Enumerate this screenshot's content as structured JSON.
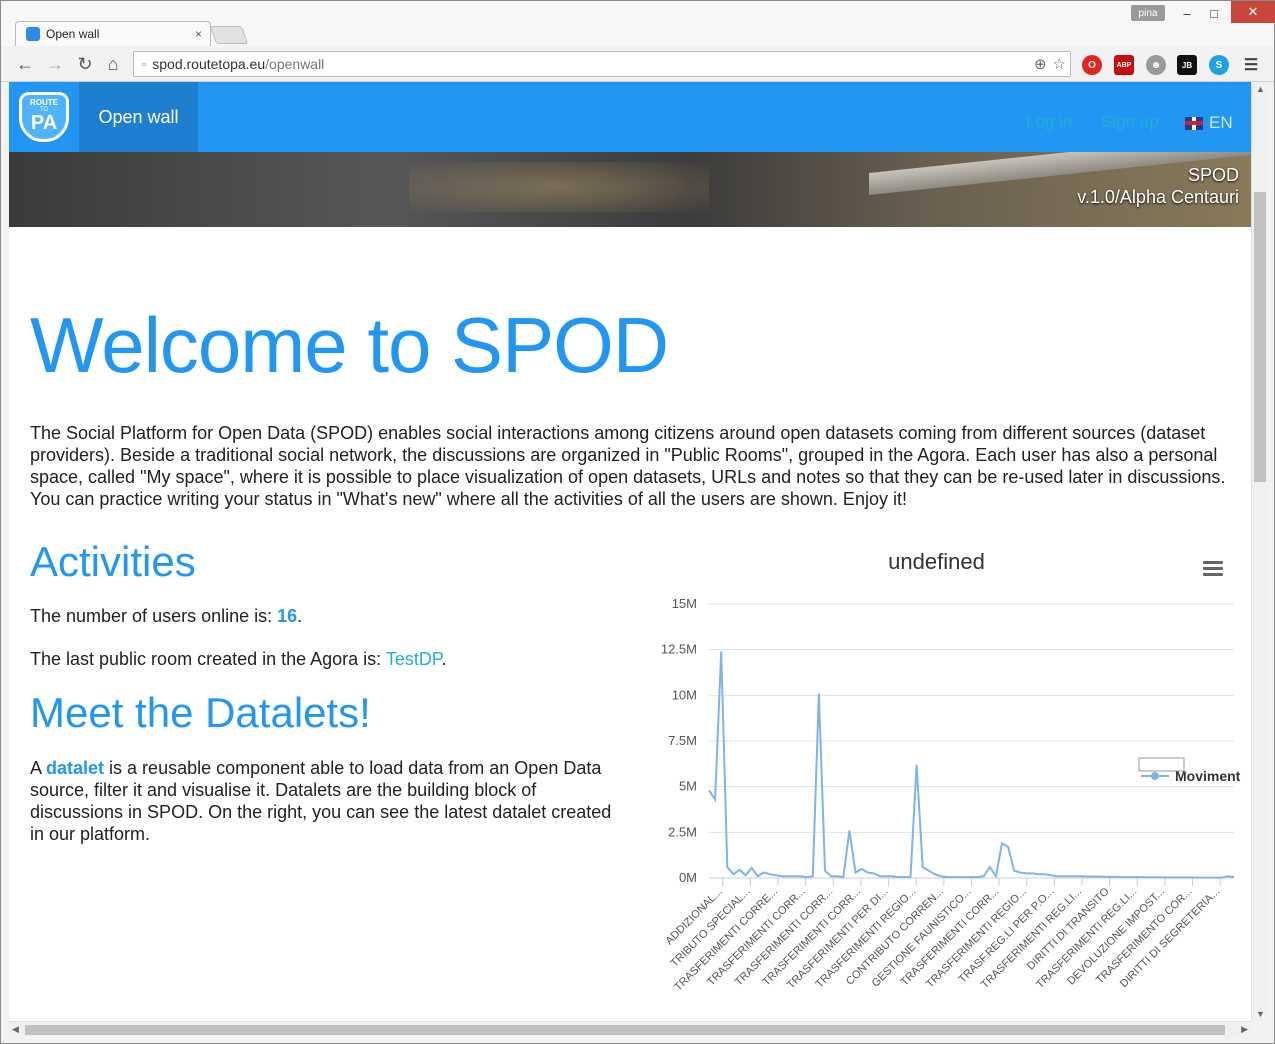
{
  "browser": {
    "tab_title": "Open wall",
    "tab_close": "×",
    "user_badge": "pina",
    "url_host": "spod.routetopa.eu",
    "url_path": "/openwall",
    "window_controls": [
      "–",
      "□",
      "✕"
    ],
    "extensions": [
      "ABP",
      "JB"
    ]
  },
  "navbar": {
    "logo_top": "ROUTE",
    "logo_mid": "TO",
    "logo_bottom": "PA",
    "active_item": "Open wall",
    "login": "Log in",
    "signup": "Sign up",
    "language": "EN"
  },
  "banner": {
    "line1": "SPOD",
    "line2": "v.1.0/Alpha Centauri"
  },
  "main": {
    "welcome_title": "Welcome to SPOD",
    "intro": "The Social Platform for Open Data (SPOD) enables social interactions among citizens around open datasets coming from different sources (dataset providers). Beside a traditional social network, the discussions are organized in \"Public Rooms\", grouped in the Agora. Each user has also a personal space, called \"My space\", where it is possible to place visualization of open datasets, URLs and notes so that they can be re-used later in discussions. You can practice writing your status in \"What's new\" where all the activities of all the users are shown. Enjoy it!",
    "activities_title": "Activities",
    "users_online_prefix": "The number of users online is: ",
    "users_online_count": "16",
    "users_online_suffix": ".",
    "last_room_prefix": "The last public room created in the Agora is: ",
    "last_room_name": "TestDP",
    "last_room_suffix": ".",
    "datalets_title": "Meet the Datalets!",
    "datalet_prefix": "A ",
    "datalet_link": "datalet",
    "datalet_text": " is a reusable component able to load data from an Open Data source, filter it and visualise it. Datalets are the building block of discussions in SPOD. On the right, you can see the latest datalet created in our platform."
  },
  "colors": {
    "accent": "#2196f3",
    "link": "#21b1d0",
    "line": "#7cb5ec"
  },
  "chart_data": {
    "type": "line",
    "title": "undefined",
    "ylim": [
      0,
      15000000
    ],
    "y_ticks": [
      "0M",
      "2.5M",
      "5M",
      "7.5M",
      "10M",
      "12.5M",
      "15M"
    ],
    "legend": [
      "Moviment"
    ],
    "legend_position": "right",
    "grid": true,
    "categories": [
      "ADDIZIONAL...",
      "TRIBUTO SPECIAL...",
      "TRASFERIMENTI CORRE...",
      "TRASFERIMENTI CORR...",
      "TRASFERIMENTI CORR...",
      "TRASFERIMENTI CORR...",
      "TRASFERIMENTI PER DI...",
      "TRASFERIMENTI REGIO...",
      "CONTRIBUTO CORREN...",
      "GESTIONE FAUNISTICO...",
      "TRASFERIMENTI CORR...",
      "TRASFERIMENTI REGIO...",
      "TRASF.REG.LI PER P.O...",
      "TRASFERIMENTI REG.LI...",
      "DIRITTI DI TRANSITO",
      "TRASFERIMENTI REG.LI...",
      "DEVOLUZIONE IMPOST...",
      "TRASFERIMENTO COR...",
      "DIRITTI DI SEGRETERIA..."
    ],
    "values": [
      4800000,
      4300000,
      12400000,
      600000,
      200000,
      450000,
      150000,
      550000,
      100000,
      300000,
      200000,
      150000,
      100000,
      100000,
      100000,
      100000,
      50000,
      100000,
      10100000,
      400000,
      100000,
      100000,
      50000,
      2600000,
      300000,
      500000,
      300000,
      250000,
      100000,
      100000,
      100000,
      50000,
      50000,
      50000,
      6200000,
      600000,
      400000,
      200000,
      100000,
      50000,
      50000,
      50000,
      50000,
      50000,
      50000,
      100000,
      600000,
      100000,
      1900000,
      1700000,
      400000,
      300000,
      250000,
      250000,
      200000,
      200000,
      150000,
      100000,
      100000,
      100000,
      100000,
      100000,
      80000,
      80000,
      80000,
      60000,
      60000,
      60000,
      50000,
      50000,
      50000,
      50000,
      40000,
      40000,
      40000,
      30000,
      30000,
      30000,
      30000,
      30000,
      20000,
      20000,
      20000,
      20000,
      20000,
      100000,
      50000
    ]
  }
}
